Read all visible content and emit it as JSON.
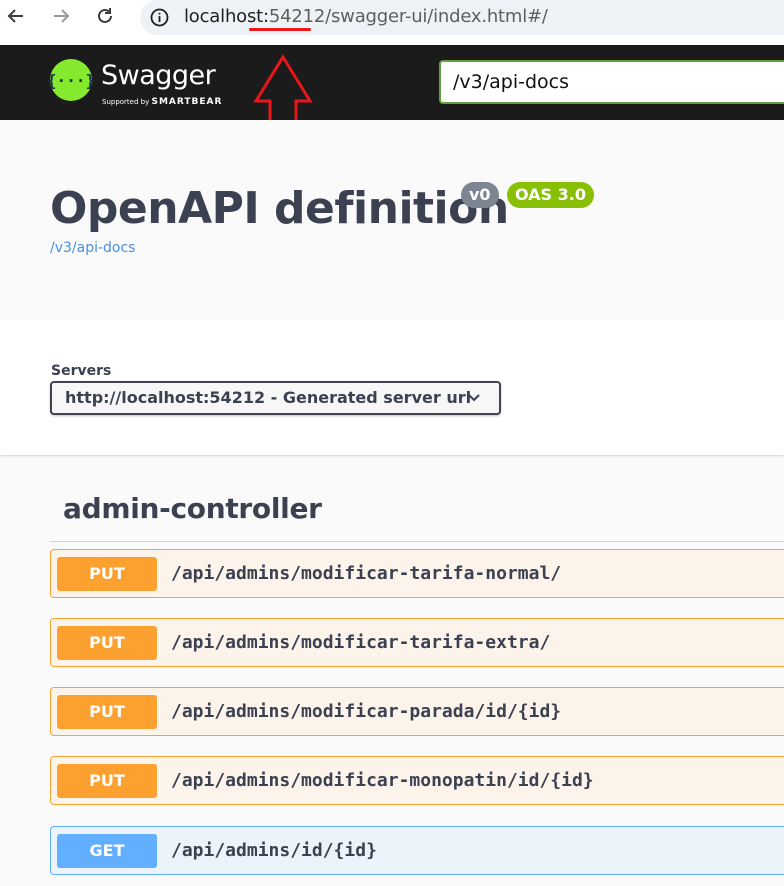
{
  "browser": {
    "url_host": "localhost:",
    "url_port": "54212",
    "url_path": "/swagger-ui/index.html#/"
  },
  "topbar": {
    "logo_symbol": "{···}",
    "brand": "Swagger",
    "supported_by": "Supported by",
    "smartbear": "SMARTBEAR",
    "spec_url": "/v3/api-docs",
    "accent_color": "#85ea2d"
  },
  "info": {
    "title": "OpenAPI definition",
    "version_badge": "v0",
    "oas_badge": "OAS 3.0",
    "docs_link": "/v3/api-docs"
  },
  "servers": {
    "label": "Servers",
    "selected": "http://localhost:54212 - Generated server url"
  },
  "controller": {
    "name": "admin-controller",
    "operations": [
      {
        "method": "PUT",
        "path": "/api/admins/modificar-tarifa-normal/"
      },
      {
        "method": "PUT",
        "path": "/api/admins/modificar-tarifa-extra/"
      },
      {
        "method": "PUT",
        "path": "/api/admins/modificar-parada/id/{id}"
      },
      {
        "method": "PUT",
        "path": "/api/admins/modificar-monopatin/id/{id}"
      },
      {
        "method": "GET",
        "path": "/api/admins/id/{id}"
      }
    ]
  },
  "colors": {
    "put": "#fca130",
    "get": "#61affe",
    "annotation": "#e8171a"
  }
}
